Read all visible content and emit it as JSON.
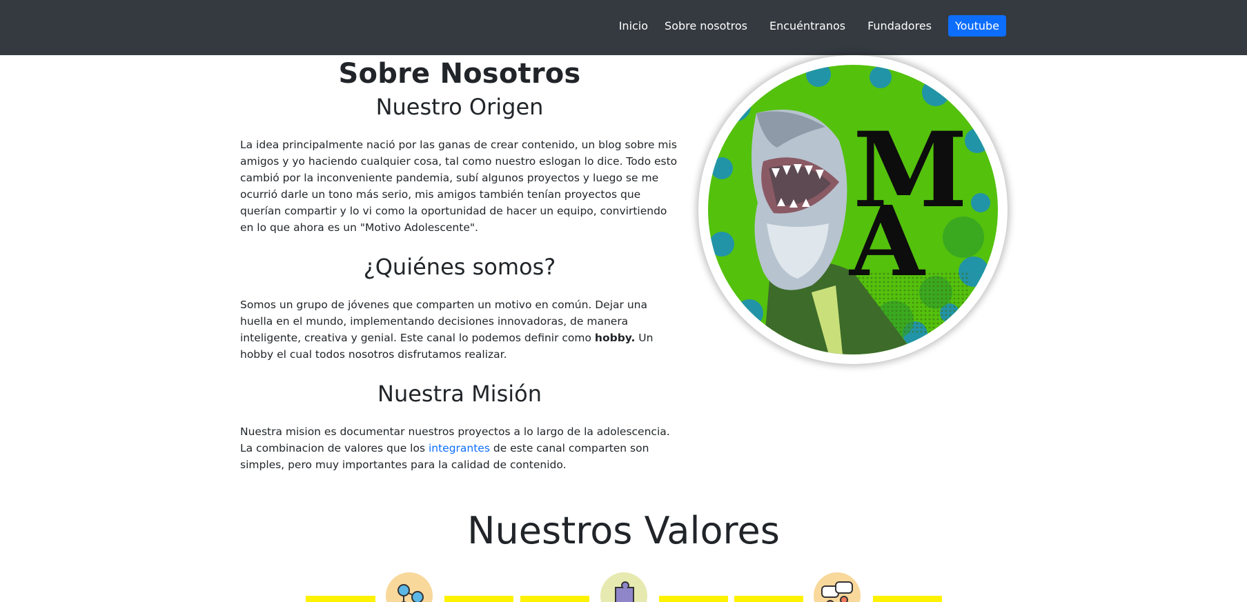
{
  "nav": {
    "items": [
      "Inicio",
      "Sobre nosotros",
      "Encuéntranos",
      "Fundadores"
    ],
    "button": "Youtube"
  },
  "about": {
    "title": "Sobre Nosotros",
    "origin": {
      "heading": "Nuestro Origen",
      "text": "La idea principalmente nació por las ganas de crear contenido, un blog sobre mis amigos y yo haciendo cualquier cosa, tal como nuestro eslogan lo dice. Todo esto cambió por la inconveniente pandemia, subí algunos proyectos y luego se me ocurrió darle un tono más serio, mis amigos también tenían proyectos que querían compartir y lo vi como la oportunidad de hacer un equipo, convirtiendo en lo que ahora es un \"Motivo Adolescente\"."
    },
    "who": {
      "heading": "¿Quiénes somos?",
      "text_before": "Somos un grupo de jóvenes que comparten un motivo en común. Dejar una huella en el mundo, implementando decisiones innovadoras, de manera inteligente, creativa y genial. Este canal lo podemos definir como ",
      "text_bold": "hobby.",
      "text_after": " Un hobby el cual todos nosotros disfrutamos realizar."
    },
    "mission": {
      "heading": "Nuestra Misión",
      "text_before": "Nuestra mision es documentar nuestros proyectos a lo largo de la adolescencia. La combinacion de valores que los ",
      "link": "integrantes",
      "text_after": " de este canal comparten son simples, pero muy importantes para la calidad de contenido."
    }
  },
  "logo": {
    "letters": "MA",
    "bg_color": "#54c10d",
    "splatter_color": "#1a8cc4"
  },
  "values": {
    "title": "Nuestros Valores",
    "bar_color": "#fff200",
    "icons": [
      "network-icon",
      "puzzle-icon",
      "chat-bubbles-icon"
    ]
  },
  "colors": {
    "navbar": "#343a40",
    "button": "#0d6efd",
    "link": "#0d6efd"
  }
}
